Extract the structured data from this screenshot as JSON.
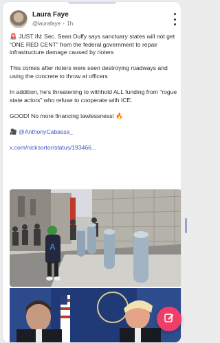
{
  "post": {
    "author": {
      "name": "Laura Faye",
      "handle": "@laurafaye",
      "separator": "•",
      "time": "1h"
    },
    "paragraphs": [
      "🚨 JUST IN: Sec. Sean Duffy says sanctuary states will not get “ONE RED CENT” from the federal government to repair infrastructure damage caused by rioters",
      "This comes after rioters were seen destroying roadways and using the concrete to throw at officers",
      "In addition, he’s threatening to withhold ALL funding from “rogue state actors” who refuse to cooperate with ICE.",
      "GOOD! No more financing lawlessness! 🔥"
    ],
    "credit": {
      "camera": "🎥",
      "mention": "@AnthonyCabassa_"
    },
    "link_text": "x.com/nicksortor/status/193466..."
  },
  "icons": {
    "more": "more-vertical-icon",
    "compose": "compose-pencil-icon"
  },
  "colors": {
    "accent": "#3d52c4",
    "fab": "#ef3f68"
  }
}
